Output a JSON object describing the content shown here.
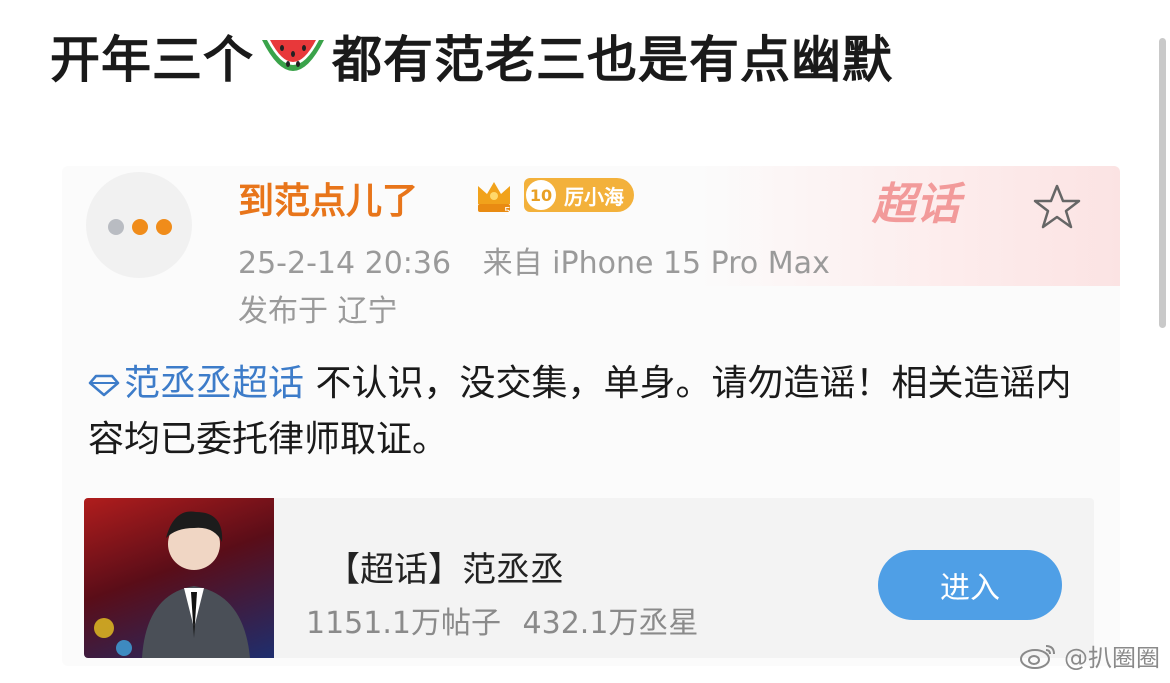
{
  "headline": {
    "before_emoji": "开年三个",
    "emoji": "watermelon-icon",
    "after_emoji": "都有范老三也是有点幽默"
  },
  "post": {
    "author": "到范点儿了",
    "crown_level": "5",
    "fan_badge": {
      "level": "10",
      "label": "厉小海"
    },
    "banner_text": "超话",
    "timestamp": "25-2-14 20:36",
    "source": "来自 iPhone 15 Pro Max",
    "location": "发布于 辽宁",
    "topic_link": "范丞丞超话",
    "body": "不认识，没交集，单身。请勿造谣！相关造谣内容均已委托律师取证。"
  },
  "card": {
    "title": "【超话】范丞丞",
    "posts": "1151.1万帖子",
    "fans": "432.1万丞星",
    "enter_label": "进入"
  },
  "watermark": "@扒圈圈",
  "colors": {
    "author": "#e8751a",
    "link": "#3d7cc9",
    "button": "#4f9fe6",
    "meta": "#9a9a9a"
  }
}
